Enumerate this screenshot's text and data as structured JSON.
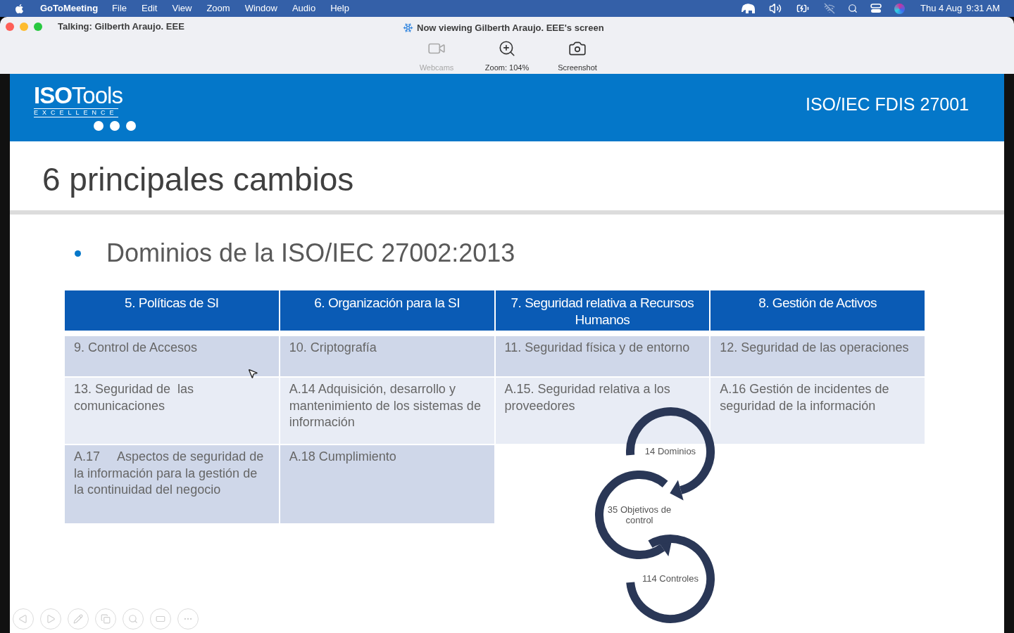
{
  "menu_bar": {
    "app_name": "GoToMeeting",
    "menus": [
      "File",
      "Edit",
      "View",
      "Zoom",
      "Window",
      "Audio",
      "Help"
    ],
    "date": "Thu 4 Aug",
    "time": "9:31 AM"
  },
  "window": {
    "talking": "Talking: Gilberth Araujo. EEE",
    "title": "Now viewing Gilberth Araujo. EEE's screen"
  },
  "toolbar": [
    {
      "label": "Webcams",
      "kind": "webcam",
      "disabled": true
    },
    {
      "label": "Zoom: 104%",
      "kind": "zoom",
      "disabled": false
    },
    {
      "label": "Screenshot",
      "kind": "screenshot",
      "disabled": false
    }
  ],
  "slide": {
    "logo": {
      "wordmark": "**ISO**Tools",
      "tagline": "EXCELLENCE"
    },
    "header_title": "ISO/IEC FDIS 27001",
    "title": "6 principales cambios",
    "bullet": "Dominios de la ISO/IEC 27002:2013",
    "table": {
      "columns": [
        "5. Políticas de SI",
        "6. Organización para la SI",
        "7. Seguridad relativa a  Recursos Humanos",
        "8. Gestión de Activos"
      ],
      "rows": [
        [
          "9. Control de Accesos",
          "10. Criptografía",
          "11. Seguridad física y de entorno",
          "12. Seguridad de las operaciones"
        ],
        [
          "13. Seguridad de  las comunicaciones",
          "A.14 Adquisición, desarrollo y mantenimiento de los sistemas de información",
          "A.15. Seguridad relativa a los proveedores",
          "A.16 Gestión de incidentes de seguridad de la información"
        ],
        [
          "A.17     Aspectos de seguridad de la información para la gestión de la continuidad del negocio",
          "A.18 Cumplimiento"
        ]
      ]
    },
    "diagram": [
      "14 Dominios",
      "35 Objetivos de control",
      "114 Controles"
    ]
  }
}
